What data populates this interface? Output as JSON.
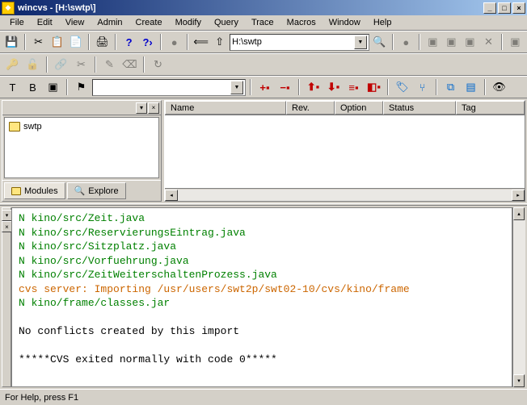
{
  "window": {
    "title": "wincvs - [H:\\swtp\\]"
  },
  "menu": {
    "items": [
      "File",
      "Edit",
      "View",
      "Admin",
      "Create",
      "Modify",
      "Query",
      "Trace",
      "Macros",
      "Window",
      "Help"
    ]
  },
  "toolbar1": {
    "path_value": "H:\\swtp"
  },
  "toolbar3": {
    "combo_value": ""
  },
  "tree": {
    "root": "swtp"
  },
  "left_tabs": {
    "modules": "Modules",
    "explore": "Explore"
  },
  "columns": {
    "name": "Name",
    "rev": "Rev.",
    "option": "Option",
    "status": "Status",
    "tag": "Tag"
  },
  "console": {
    "lines": [
      {
        "cls": "green",
        "text": "N kino/src/Zeit.java"
      },
      {
        "cls": "green",
        "text": "N kino/src/ReservierungsEintrag.java"
      },
      {
        "cls": "green",
        "text": "N kino/src/Sitzplatz.java"
      },
      {
        "cls": "green",
        "text": "N kino/src/Vorfuehrung.java"
      },
      {
        "cls": "green",
        "text": "N kino/src/ZeitWeiterschaltenProzess.java"
      },
      {
        "cls": "orange",
        "text": "cvs server: Importing /usr/users/swt2p/swt02-10/cvs/kino/frame"
      },
      {
        "cls": "green",
        "text": "N kino/frame/classes.jar"
      },
      {
        "cls": "black",
        "text": ""
      },
      {
        "cls": "black",
        "text": "No conflicts created by this import"
      },
      {
        "cls": "black",
        "text": ""
      },
      {
        "cls": "black",
        "text": "*****CVS exited normally with code 0*****"
      }
    ]
  },
  "status": {
    "text": "For Help, press F1"
  }
}
